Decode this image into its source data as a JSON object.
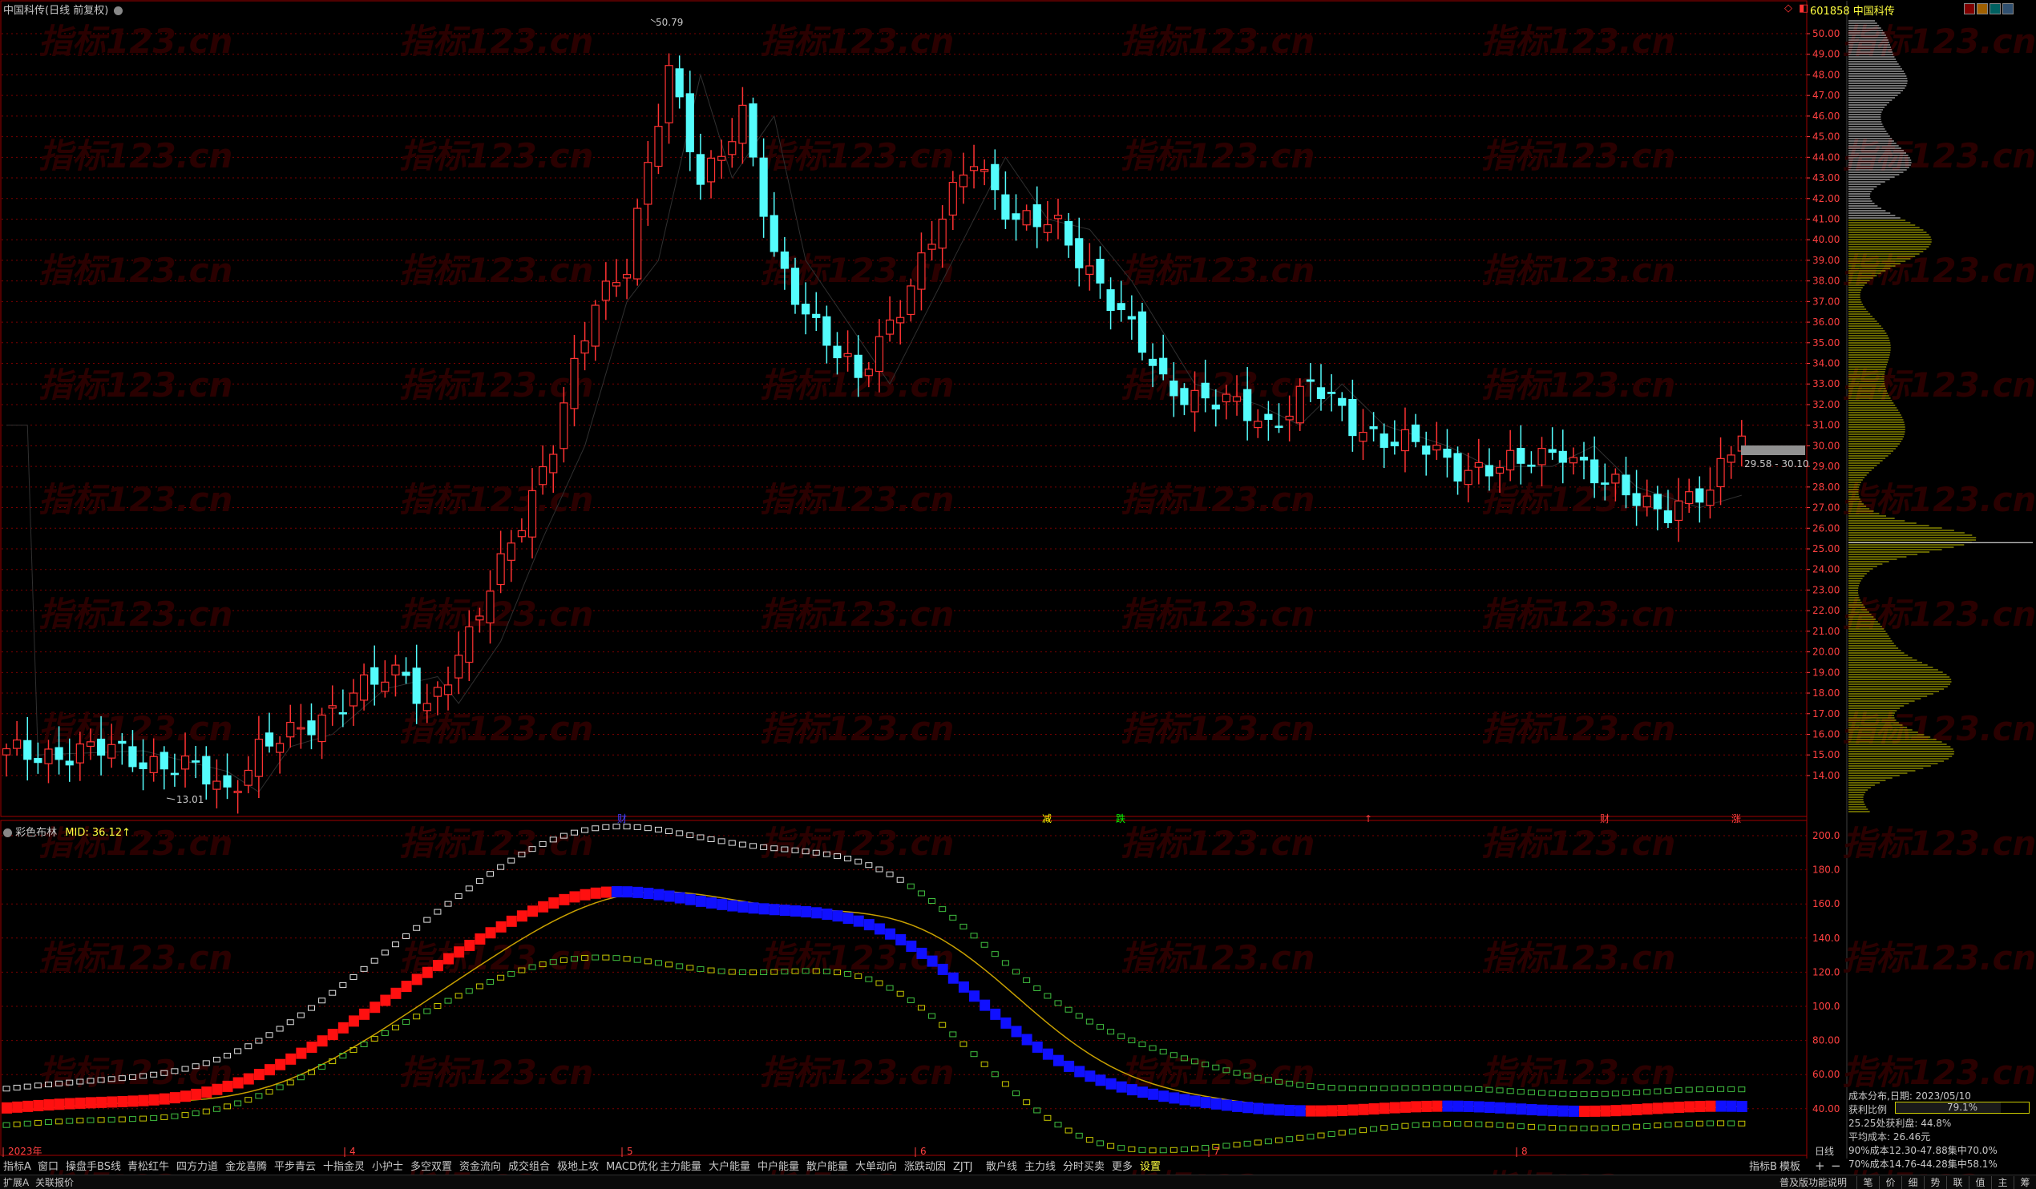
{
  "header": {
    "title": "中国科传(日线 前复权)",
    "stock_code_name": "601858 中国科传",
    "high_marker": "50.79",
    "low_marker": "13.01",
    "price_range_label": "29.58 - 30.10"
  },
  "watermark": "指标123.cn",
  "price_axis": [
    "50.00",
    "49.00",
    "48.00",
    "47.00",
    "46.00",
    "45.00",
    "44.00",
    "43.00",
    "42.00",
    "41.00",
    "40.00",
    "39.00",
    "38.00",
    "37.00",
    "36.00",
    "35.00",
    "34.00",
    "33.00",
    "32.00",
    "31.00",
    "30.00",
    "29.00",
    "28.00",
    "27.00",
    "26.00",
    "25.00",
    "24.00",
    "23.00",
    "22.00",
    "21.00",
    "20.00",
    "19.00",
    "18.00",
    "17.00",
    "16.00",
    "15.00",
    "14.00"
  ],
  "signals": [
    {
      "text": "财",
      "color": "#4040ff"
    },
    {
      "text": "减",
      "color": "#ffff00"
    },
    {
      "text": "跌",
      "color": "#00ff00"
    },
    {
      "text": "↑",
      "color": "#ff4040"
    },
    {
      "text": "财",
      "color": "#ff4040"
    },
    {
      "text": "涨",
      "color": "#ff4040"
    }
  ],
  "indicator": {
    "name": "彩色布林",
    "value_label": "MID: 36.12↑",
    "axis": [
      "200.0",
      "180.0",
      "160.0",
      "140.0",
      "120.0",
      "100.0",
      "80.00",
      "60.00",
      "40.00"
    ]
  },
  "date_axis": {
    "labels": [
      "2023年",
      "4",
      "5",
      "6",
      "7",
      "8"
    ],
    "period": "日线"
  },
  "cost_distribution": {
    "title": "成本分布,日期: 2023/05/10",
    "profit_label": "获利比例",
    "profit_value": "79.1%",
    "profit_fraction": 0.791,
    "line1": "25.25处获利盘: 44.8%",
    "line2": "平均成本: 26.46元",
    "line3": "90%成本12.30-47.88集中70.0%",
    "line4": "70%成本14.76-44.28集中58.1%"
  },
  "indicator_tabs": [
    "指标A",
    "窗口",
    "操盘手BS线",
    "青松红牛",
    "四方力道",
    "金龙喜腾",
    "平步青云",
    "十指金灵",
    "小护士",
    "多空双置",
    "资金流向",
    "成交组合",
    "极地上攻",
    "MACD优化",
    "主力能量",
    "大户能量",
    "中户能量",
    "散户能量",
    "大单动向",
    "涨跌动因",
    "ZJTJ",
    "散户线",
    "主力线",
    "分时买卖",
    "更多",
    "设置"
  ],
  "bottom_right": {
    "indicator_b": "指标B",
    "template": "模板",
    "plus": "+",
    "minus": "−"
  },
  "bottom_bar": {
    "left": [
      "扩展A",
      "关联报价"
    ],
    "info": "普及版功能说明",
    "tabs": [
      "笔",
      "价",
      "细",
      "势",
      "联",
      "值",
      "主",
      "筹"
    ]
  },
  "colors": {
    "up": "#ff3232",
    "down": "#54fcfc",
    "grid": "#7a0000",
    "border": "#a00000",
    "chip_yellow": "#c8c800",
    "chip_white": "#e0e0e0"
  }
}
